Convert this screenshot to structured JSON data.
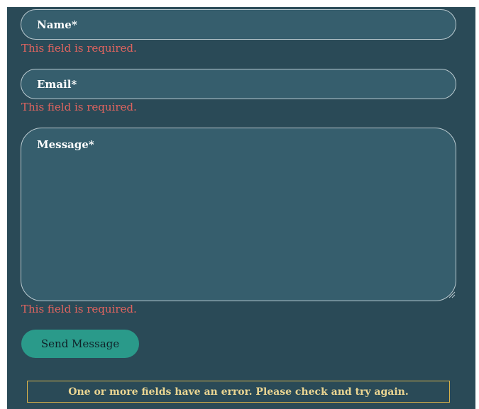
{
  "form": {
    "name_placeholder": "Name*",
    "email_placeholder": "Email*",
    "message_placeholder": "Message*",
    "name_error": "This field is required.",
    "email_error": "This field is required.",
    "message_error": "This field is required.",
    "submit_label": "Send Message",
    "response_message": "One or more fields have an error. Please check and try again."
  },
  "colors": {
    "panel_background": "#2a4a57",
    "field_background": "#365e6d",
    "error_text": "#e0645f",
    "submit_button": "#2a9a8a",
    "response_border": "#d9b24a",
    "response_text": "#ead592"
  }
}
